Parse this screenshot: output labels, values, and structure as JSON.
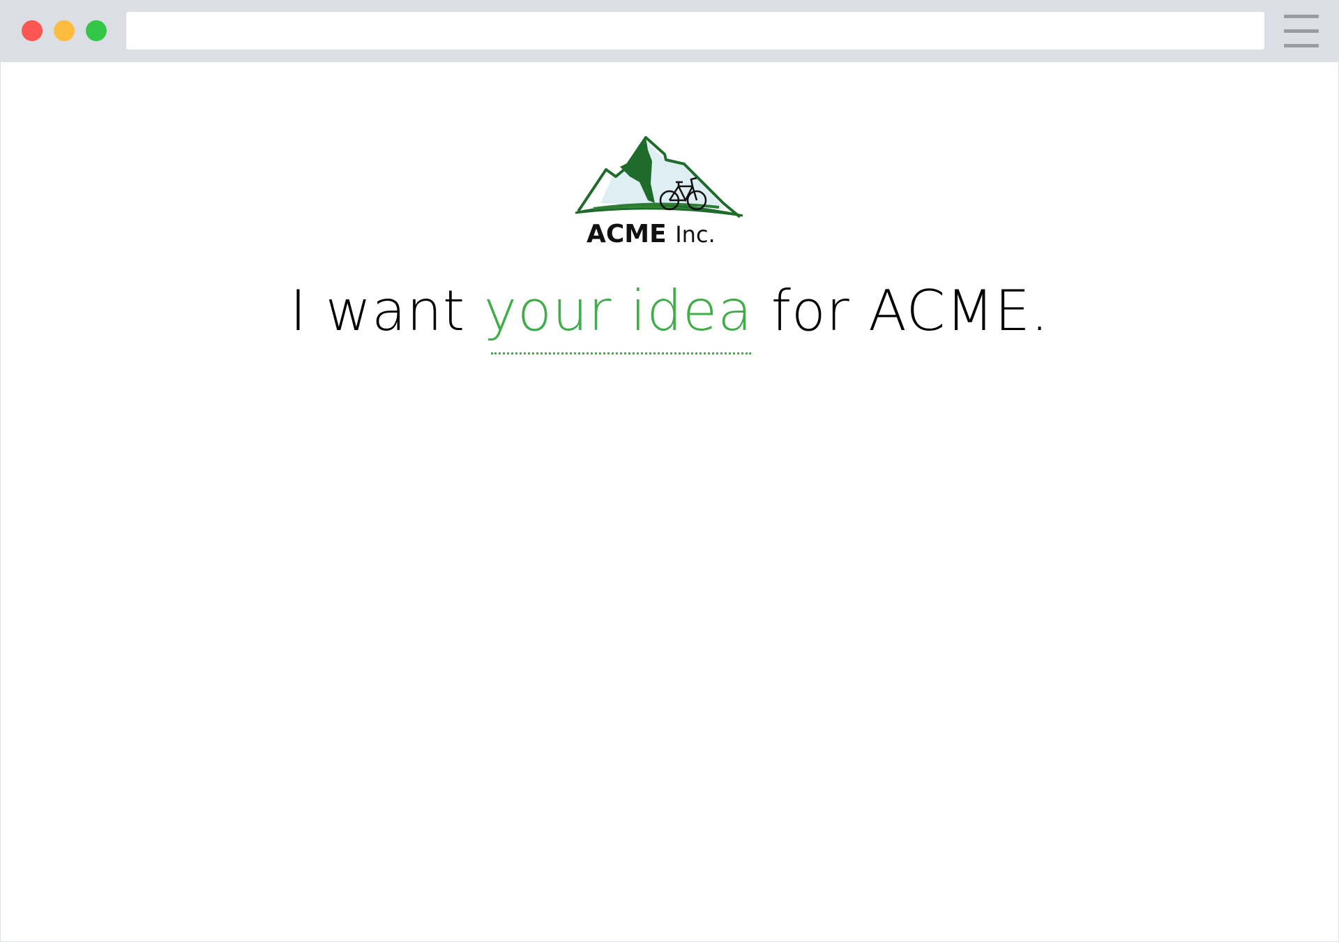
{
  "browser": {
    "address_value": "",
    "colors": {
      "close": "#fc5753",
      "minimize": "#fdbc40",
      "maximize": "#33c748",
      "chrome": "#dcdee5"
    },
    "menu_icon": "hamburger-menu-icon"
  },
  "logo": {
    "wordmark": "ACME Inc.",
    "icon": "mountain-bicycle-logo"
  },
  "headline": {
    "prefix": "I want",
    "highlight": "your idea",
    "suffix": "for ACME.",
    "highlight_color": "#3fae49"
  }
}
